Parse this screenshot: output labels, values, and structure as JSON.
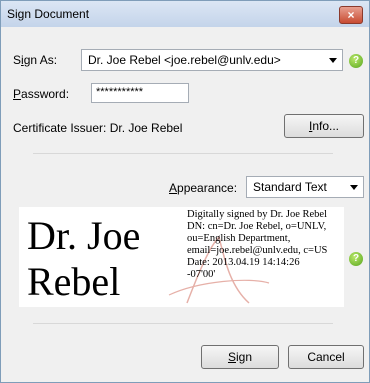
{
  "window": {
    "title": "Sign Document"
  },
  "sign_as": {
    "label_prefix": "S",
    "label_accel": "i",
    "label_rest": "gn As:",
    "value": "Dr. Joe Rebel <joe.rebel@unlv.edu>"
  },
  "password": {
    "label_accel": "P",
    "label_rest": "assword:",
    "value": "***********"
  },
  "certificate": {
    "issuer_text": "Certificate Issuer: Dr. Joe Rebel",
    "info_accel": "I",
    "info_rest": "nfo..."
  },
  "appearance": {
    "label_accel": "A",
    "label_rest": "ppearance:",
    "value": "Standard Text"
  },
  "preview": {
    "name_line1": "Dr. Joe",
    "name_line2": "Rebel",
    "details": [
      "Digitally signed by Dr. Joe Rebel",
      "DN: cn=Dr. Joe Rebel, o=UNLV,",
      "ou=English Department,",
      "email=joe.rebel@unlv.edu, c=US",
      "Date: 2013.04.19 14:14:26",
      "-07'00'"
    ]
  },
  "buttons": {
    "sign_accel": "S",
    "sign_rest": "ign",
    "cancel": "Cancel",
    "close_glyph": "×"
  },
  "icons": {
    "help": "?"
  },
  "colors": {
    "title_bar": "#c4d4ea",
    "close": "#c84b32",
    "help": "#58a51e",
    "watermark": "#e6b0a8"
  }
}
